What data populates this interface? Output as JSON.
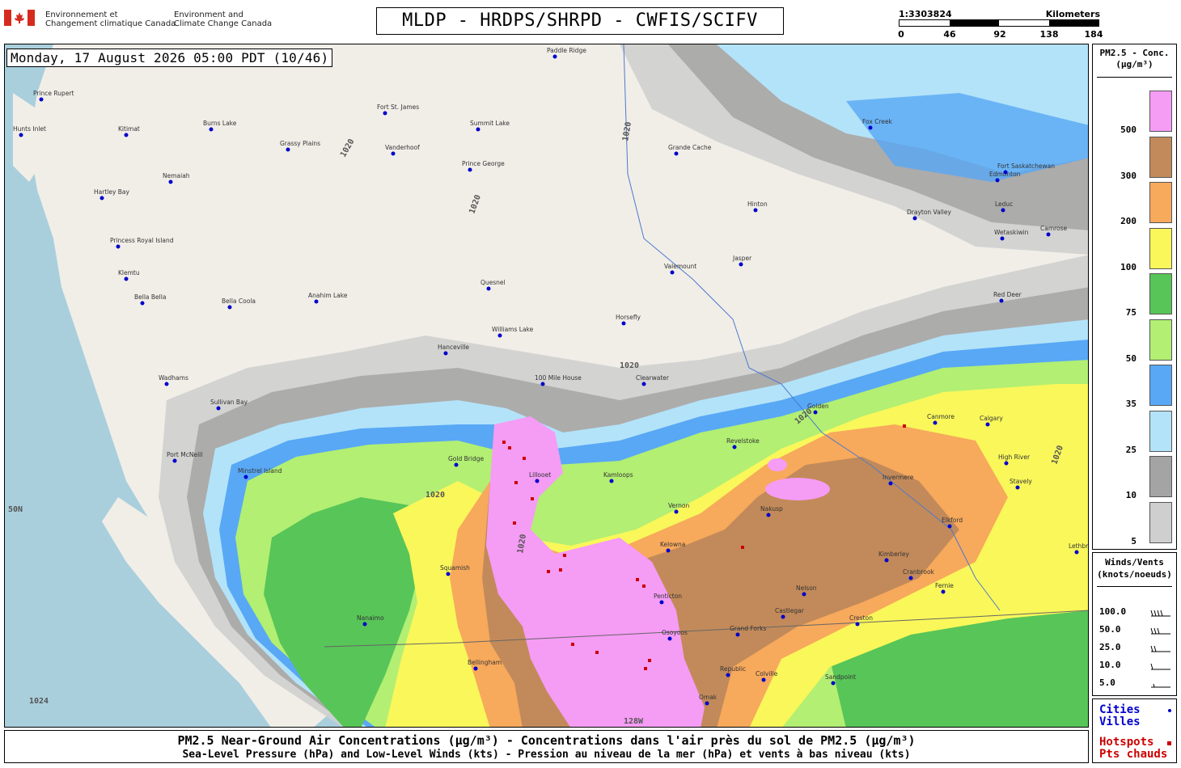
{
  "header": {
    "org_fr": [
      "Environnement et",
      "Changement climatique Canada"
    ],
    "org_en": [
      "Environment and",
      "Climate Change Canada"
    ],
    "title": "MLDP - HRDPS/SHRPD - CWFIS/SCIFV"
  },
  "scale": {
    "ratio": "1:3303824",
    "unit": "Kilometers",
    "ticks": [
      "0",
      "46",
      "92",
      "138",
      "184"
    ]
  },
  "map": {
    "datetime": "Monday, 17 August 2026 05:00 PDT (10/46)",
    "isobar_labels": [
      "1020",
      "1024"
    ],
    "grid_labels": [
      "50N",
      "128W"
    ],
    "cities": [
      {
        "name": "Prince Rupert"
      },
      {
        "name": "Hunts Inlet"
      },
      {
        "name": "Kitimat"
      },
      {
        "name": "Burns Lake"
      },
      {
        "name": "Grassy Plains"
      },
      {
        "name": "Fort St. James"
      },
      {
        "name": "Vanderhoof"
      },
      {
        "name": "Summit Lake"
      },
      {
        "name": "Prince George"
      },
      {
        "name": "Hartley Bay"
      },
      {
        "name": "Nemaiah"
      },
      {
        "name": "Princess Royal Island"
      },
      {
        "name": "Klemtu"
      },
      {
        "name": "Bella Bella"
      },
      {
        "name": "Bella Coola"
      },
      {
        "name": "Anahim Lake"
      },
      {
        "name": "Quesnel"
      },
      {
        "name": "Williams Lake"
      },
      {
        "name": "Horsefly"
      },
      {
        "name": "Grande Cache"
      },
      {
        "name": "Hinton"
      },
      {
        "name": "Jasper"
      },
      {
        "name": "Valemount"
      },
      {
        "name": "Hanceville"
      },
      {
        "name": "Wadhams"
      },
      {
        "name": "100 Mile House"
      },
      {
        "name": "Clearwater"
      },
      {
        "name": "Sullivan Bay"
      },
      {
        "name": "Port McNeill"
      },
      {
        "name": "Minstrel Island"
      },
      {
        "name": "Gold Bridge"
      },
      {
        "name": "Lillooet"
      },
      {
        "name": "Kamloops"
      },
      {
        "name": "Vernon"
      },
      {
        "name": "Kelowna"
      },
      {
        "name": "Penticton"
      },
      {
        "name": "Osoyoos"
      },
      {
        "name": "Nakusp"
      },
      {
        "name": "Revelstoke"
      },
      {
        "name": "Golden"
      },
      {
        "name": "Canmore"
      },
      {
        "name": "Calgary"
      },
      {
        "name": "High River"
      },
      {
        "name": "Invermere"
      },
      {
        "name": "Kimberley"
      },
      {
        "name": "Cranbrook"
      },
      {
        "name": "Fernie"
      },
      {
        "name": "Elkford"
      },
      {
        "name": "Nelson"
      },
      {
        "name": "Castlegar"
      },
      {
        "name": "Creston"
      },
      {
        "name": "Grand Forks"
      },
      {
        "name": "Republic"
      },
      {
        "name": "Colville"
      },
      {
        "name": "Omak"
      },
      {
        "name": "Bellingham"
      },
      {
        "name": "Squamish"
      },
      {
        "name": "Nanaimo"
      },
      {
        "name": "Edmonton"
      },
      {
        "name": "Leduc"
      },
      {
        "name": "Drayton Valley"
      },
      {
        "name": "Fox Creek"
      },
      {
        "name": "Fort Saskatchewan"
      },
      {
        "name": "Camrose"
      },
      {
        "name": "Wetaskiwin"
      },
      {
        "name": "Red Deer"
      },
      {
        "name": "Stavely"
      },
      {
        "name": "Lethbridge"
      },
      {
        "name": "Sandpoint"
      },
      {
        "name": "Paddle Ridge"
      }
    ]
  },
  "legend": {
    "title": [
      "PM2.5 - Conc.",
      "(µg/m³)"
    ],
    "bins": [
      {
        "label": "500",
        "color": "#f59cf5"
      },
      {
        "label": "300",
        "color": "#c28a5a"
      },
      {
        "label": "200",
        "color": "#f7a95c"
      },
      {
        "label": "100",
        "color": "#f9f75a"
      },
      {
        "label": "75",
        "color": "#58c558"
      },
      {
        "label": "50",
        "color": "#b2ef73"
      },
      {
        "label": "35",
        "color": "#58a8f5"
      },
      {
        "label": "25",
        "color": "#b3e3f9"
      },
      {
        "label": "10",
        "color": "#a4a4a4"
      },
      {
        "label": "5",
        "color": "#cfcfcf"
      }
    ]
  },
  "winds": {
    "title": [
      "Winds/Vents",
      "(knots/noeuds)"
    ],
    "rows": [
      {
        "label": "100.0",
        "icon": "wind-barb-100"
      },
      {
        "label": "50.0",
        "icon": "wind-barb-50"
      },
      {
        "label": "25.0",
        "icon": "wind-barb-25"
      },
      {
        "label": "10.0",
        "icon": "wind-barb-10"
      },
      {
        "label": "5.0",
        "icon": "wind-barb-5"
      }
    ]
  },
  "key": {
    "cities": [
      "Cities",
      "Villes"
    ],
    "hotspots": [
      "Hotspots",
      "Pts chauds"
    ],
    "colors": {
      "city": "#0000cc",
      "hotspot": "#cc0000"
    }
  },
  "footer": {
    "line1": "PM2.5 Near-Ground Air Concentrations (µg/m³) - Concentrations dans l'air près du sol de PM2.5 (µg/m³)",
    "line2": "Sea-Level Pressure (hPa) and Low-Level Winds (kts) - Pression au niveau de la mer (hPa) et vents à bas niveau (kts)"
  }
}
